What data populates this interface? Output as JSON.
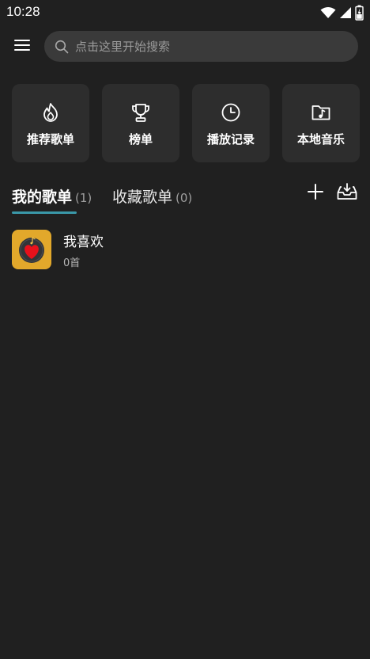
{
  "status_bar": {
    "time": "10:28",
    "icons": [
      "wifi-icon",
      "signal-icon",
      "battery-icon"
    ]
  },
  "top_bar": {
    "menu_icon": "hamburger-menu-icon",
    "search": {
      "icon": "search-icon",
      "placeholder": "点击这里开始搜索"
    }
  },
  "quick_actions": [
    {
      "label": "推荐歌单",
      "icon": "flame-icon"
    },
    {
      "label": "榜单",
      "icon": "trophy-icon"
    },
    {
      "label": "播放记录",
      "icon": "clock-icon"
    },
    {
      "label": "本地音乐",
      "icon": "music-folder-icon"
    }
  ],
  "tabs": {
    "mine": {
      "label": "我的歌单",
      "count": "(1)"
    },
    "favorites": {
      "label": "收藏歌单",
      "count": "(0)"
    },
    "add_icon": "plus-icon",
    "import_icon": "inbox-download-icon"
  },
  "playlists": [
    {
      "title": "我喜欢",
      "count": "0首",
      "cover_icon": "heart-record-icon"
    }
  ],
  "colors": {
    "background": "#202020",
    "card": "#2d2d2d",
    "search_bg": "#3a3a3a",
    "accent": "#3a98a8",
    "cover": "#e2a82b",
    "heart": "#e8111b"
  }
}
